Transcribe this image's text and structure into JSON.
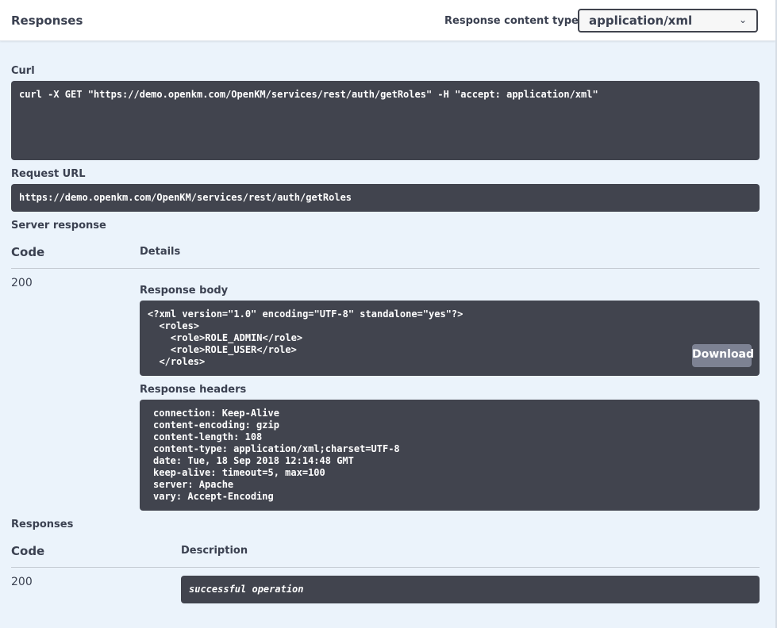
{
  "header": {
    "title": "Responses",
    "content_type_label": "Response content type",
    "content_type_value": "application/xml"
  },
  "curl": {
    "label": "Curl",
    "command": "curl -X GET \"https://demo.openkm.com/OpenKM/services/rest/auth/getRoles\" -H \"accept: application/xml\""
  },
  "request_url": {
    "label": "Request URL",
    "value": "https://demo.openkm.com/OpenKM/services/rest/auth/getRoles"
  },
  "server_response": {
    "label": "Server response",
    "col_code": "Code",
    "col_details": "Details",
    "code": "200",
    "body_label": "Response body",
    "body_lines": [
      "<?xml version=\"1.0\" encoding=\"UTF-8\" standalone=\"yes\"?>",
      "  <roles>",
      "    <role>ROLE_ADMIN</role>",
      "    <role>ROLE_USER</role>",
      "  </roles>"
    ],
    "download_label": "Download",
    "headers_label": "Response headers",
    "headers": [
      "connection: Keep-Alive",
      "content-encoding: gzip",
      "content-length: 108",
      "content-type: application/xml;charset=UTF-8",
      "date: Tue, 18 Sep 2018 12:14:48 GMT",
      "keep-alive: timeout=5, max=100",
      "server: Apache",
      "vary: Accept-Encoding"
    ]
  },
  "responses": {
    "label": "Responses",
    "col_code": "Code",
    "col_description": "Description",
    "code": "200",
    "description": "successful operation"
  },
  "icons": {
    "select_chevron": "chevron-down-icon"
  }
}
